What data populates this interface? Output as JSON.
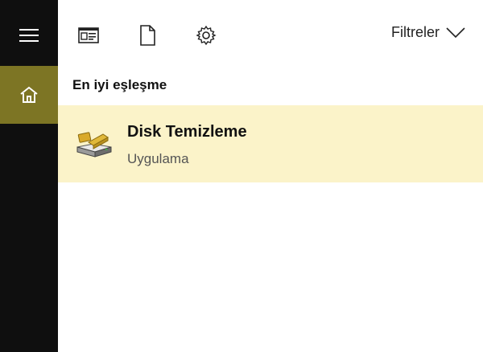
{
  "topbar": {
    "filters_label": "Filtreler"
  },
  "results": {
    "section_title": "En iyi eşleşme",
    "best_match": {
      "name": "Disk Temizleme",
      "type": "Uygulama"
    }
  },
  "colors": {
    "rail": "#0f0f0f",
    "rail_active": "#7d7524",
    "highlight": "#fbf3c9"
  },
  "icons": [
    "hamburger-menu-icon",
    "home-icon",
    "documents-icon",
    "document-icon",
    "gear-icon",
    "chevron-down-icon",
    "disk-cleanup-icon"
  ]
}
